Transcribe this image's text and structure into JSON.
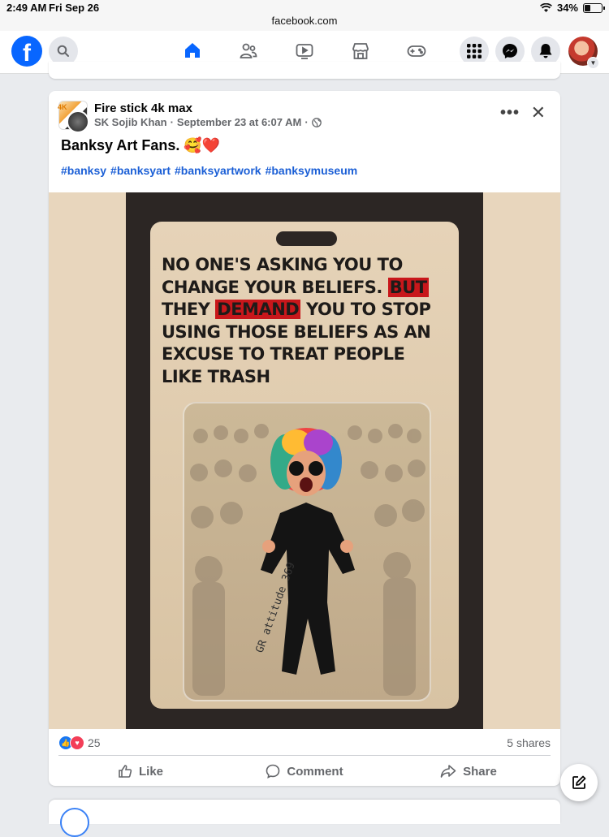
{
  "status_bar": {
    "time": "2:49 AM",
    "date": "Fri Sep 26",
    "url": "facebook.com",
    "battery": "34%",
    "battery_level": 0.34
  },
  "nav": {
    "logo": "f",
    "tabs": [
      "home-icon",
      "friends-icon",
      "video-icon",
      "marketplace-icon",
      "gaming-icon"
    ],
    "active_tab": "home",
    "right_buttons": [
      "menu-grid-icon",
      "messenger-icon",
      "notifications-icon",
      "account-avatar"
    ]
  },
  "post": {
    "page_name": "Fire stick 4k max",
    "page_badge": "4K",
    "author": "SK Sojib Khan",
    "date": "September 23 at 6:07 AM",
    "separator": "·",
    "caption": "Banksy Art Fans. 🥰❤️",
    "hashtags": [
      "#banksy",
      "#banksyart",
      "#banksyartwork",
      "#banksymuseum"
    ],
    "image": {
      "line1": "NO ONE'S ASKING YOU TO",
      "line2a": "CHANGE YOUR BELIEFS. ",
      "line2b": "BUT",
      "line3a": "THEY ",
      "line3b": "DEMAND",
      "line3c": " YOU TO STOP",
      "line4": "USING THOSE BELIEFS AS AN",
      "line5": "EXCUSE TO TREAT PEOPLE",
      "line6": "LIKE TRASH",
      "signature": "GR attitude 369"
    },
    "reaction_count": "25",
    "shares": "5 shares",
    "actions": {
      "like": "Like",
      "comment": "Comment",
      "share": "Share"
    }
  },
  "colors": {
    "accent": "#0866ff",
    "hashtag": "#1b5fd6",
    "like": "#1877f2",
    "love": "#f33e58"
  }
}
